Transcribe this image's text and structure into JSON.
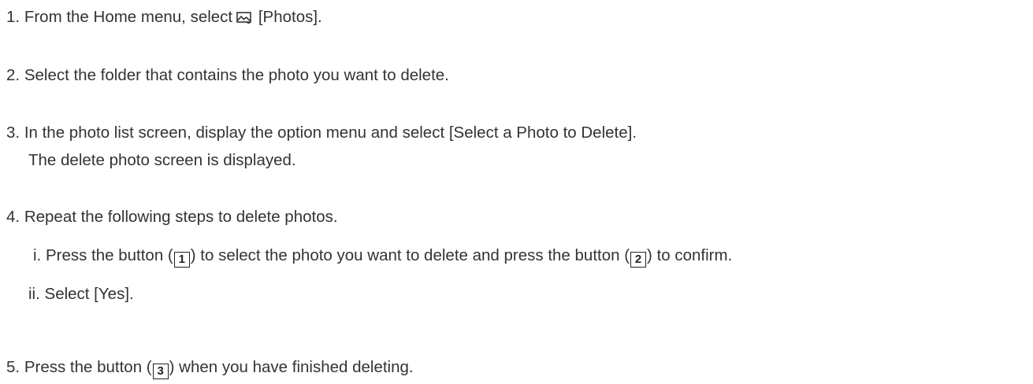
{
  "steps": {
    "s1": {
      "num": "1.",
      "pre": "From the Home menu, select",
      "icon": "photo-icon",
      "post": "[Photos]."
    },
    "s2": {
      "num": "2.",
      "text": "Select the folder that contains the photo you want to delete."
    },
    "s3": {
      "num": "3.",
      "text": "In the photo list screen, display the option menu and select [Select a Photo to Delete].",
      "note": "The delete photo screen is displayed."
    },
    "s4": {
      "num": "4.",
      "text": "Repeat the following steps to delete photos.",
      "sub1": {
        "num": "i.",
        "a": "Press the button (",
        "btn1": "1",
        "b": ") to select the photo you want to delete and press the button (",
        "btn2": "2",
        "c": ") to confirm."
      },
      "sub2": {
        "num": "ii.",
        "text": "Select [Yes]."
      }
    },
    "s5": {
      "num": "5.",
      "a": "Press the button (",
      "btn": "3",
      "b": ") when you have finished deleting."
    }
  }
}
